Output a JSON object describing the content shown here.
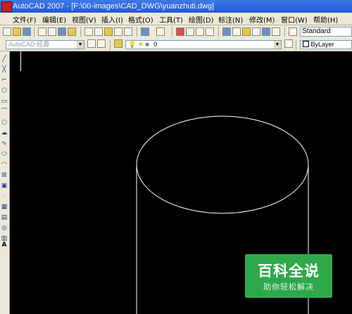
{
  "window": {
    "title": "AutoCAD 2007 - [F:\\00-images\\CAD_DWG\\yuanzhuti.dwg]"
  },
  "menu": {
    "items": [
      "文件(F)",
      "编辑(E)",
      "视图(V)",
      "插入(I)",
      "格式(O)",
      "工具(T)",
      "绘图(D)",
      "标注(N)",
      "修改(M)",
      "窗口(W)",
      "帮助(H)"
    ]
  },
  "toolbar": {
    "text_style": "Standard",
    "workspace": "AutoCAD 经典",
    "layer": "0",
    "color": "ByLayer"
  },
  "drawing": {
    "shape": "cylinder",
    "stroke_color": "#ffffff",
    "background": "#000000"
  },
  "watermark": {
    "title": "百科全说",
    "subtitle": "助你轻松解决",
    "color": "#2fa84a"
  }
}
